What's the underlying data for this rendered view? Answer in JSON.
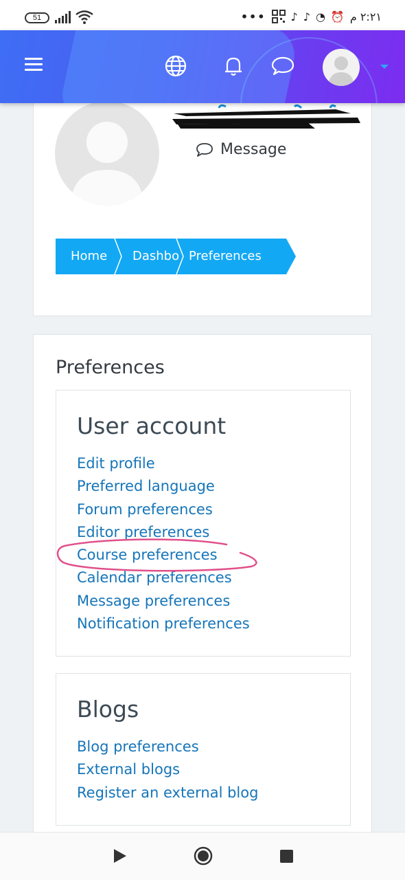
{
  "status_bar": {
    "battery": "51",
    "time": "٢:٢١ م",
    "overflow": "•••",
    "icons": [
      "signal-icon",
      "wifi-icon",
      "qr-icon",
      "tiktok-icon",
      "tiktok-icon",
      "chat-icon",
      "alarm-icon"
    ]
  },
  "header": {
    "icons": [
      "menu-icon",
      "globe-icon",
      "bell-icon",
      "chat-icon",
      "avatar",
      "dropdown-caret"
    ],
    "brand_colors": {
      "gradient_start": "#3f6ef5",
      "gradient_end": "#7c2df0"
    }
  },
  "profile": {
    "message_label": "Message"
  },
  "breadcrumb": {
    "items": [
      "Home",
      "Dashbo",
      "Preferences"
    ],
    "color": "#13a8f4"
  },
  "preferences": {
    "title": "Preferences",
    "user_account": {
      "heading": "User account",
      "links": [
        "Edit profile",
        "Preferred language",
        "Forum preferences",
        "Editor preferences",
        "Course preferences",
        "Calendar preferences",
        "Message preferences",
        "Notification preferences"
      ]
    },
    "blogs": {
      "heading": "Blogs",
      "links": [
        "Blog preferences",
        "External blogs",
        "Register an external blog"
      ]
    },
    "link_color": "#1575b9",
    "highlight_color": "#e0508a"
  },
  "nav_bar": {
    "icons": [
      "back-icon",
      "home-icon",
      "recents-icon"
    ]
  }
}
